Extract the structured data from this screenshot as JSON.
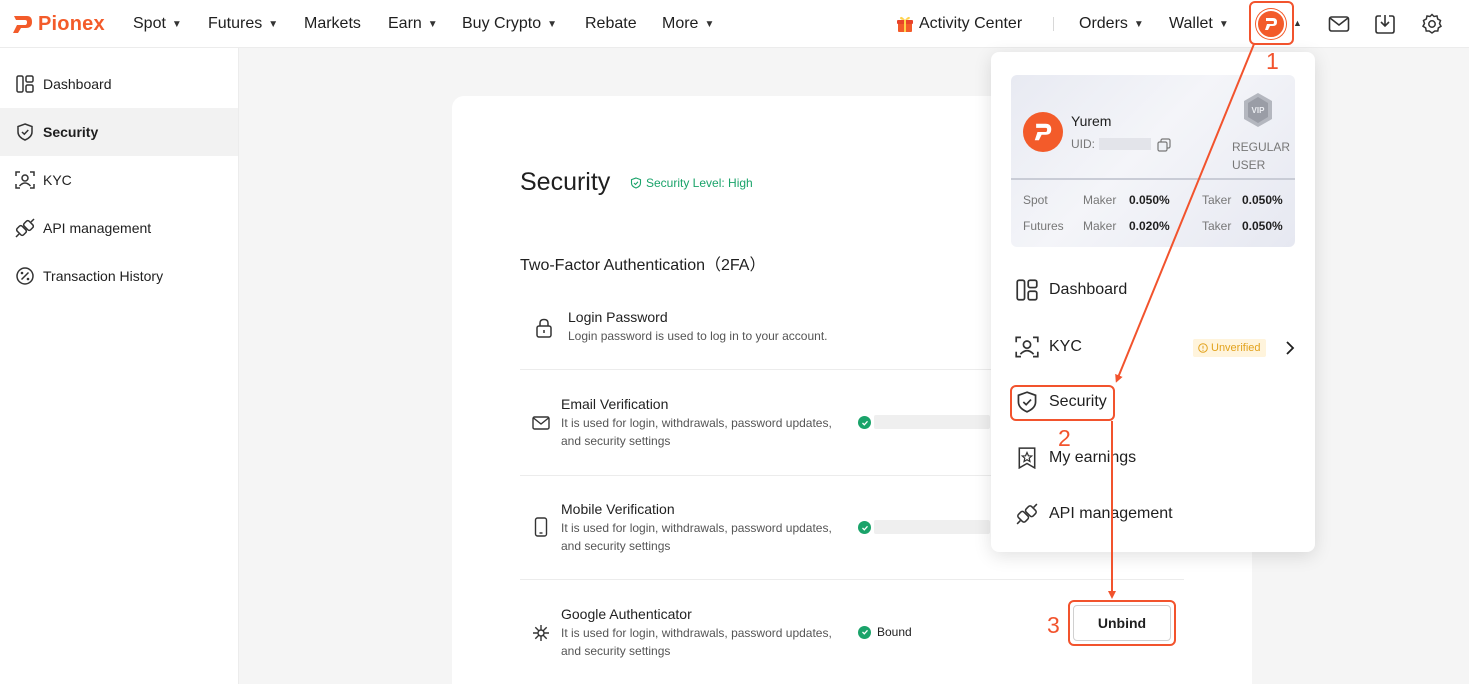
{
  "brand": {
    "name": "Pionex",
    "color": "#f35b2a"
  },
  "nav": {
    "items": [
      {
        "label": "Spot",
        "has_caret": true
      },
      {
        "label": "Futures",
        "has_caret": true
      },
      {
        "label": "Markets",
        "has_caret": false
      },
      {
        "label": "Earn",
        "has_caret": true
      },
      {
        "label": "Buy Crypto",
        "has_caret": true
      },
      {
        "label": "Rebate",
        "has_caret": false
      },
      {
        "label": "More",
        "has_caret": true
      }
    ],
    "activity_center": "Activity Center",
    "orders": "Orders",
    "wallet": "Wallet",
    "icons": [
      "gift-icon",
      "avatar-icon",
      "mail-icon",
      "download-icon",
      "settings-icon"
    ]
  },
  "sidebar": {
    "items": [
      {
        "label": "Dashboard",
        "icon": "dashboard-icon",
        "active": false
      },
      {
        "label": "Security",
        "icon": "shield-icon",
        "active": true
      },
      {
        "label": "KYC",
        "icon": "kyc-icon",
        "active": false
      },
      {
        "label": "API management",
        "icon": "api-icon",
        "active": false
      },
      {
        "label": "Transaction History",
        "icon": "percent-icon",
        "active": false
      }
    ]
  },
  "main": {
    "title": "Security",
    "security_level": "Security Level: High",
    "section_title": "Two-Factor Authentication（2FA）",
    "rows": [
      {
        "title": "Login Password",
        "desc": "Login password is used to log in to your account.",
        "icon": "lock-icon"
      },
      {
        "title": "Email Verification",
        "desc": "It is used for login, withdrawals, password updates, and security settings",
        "icon": "mail-icon"
      },
      {
        "title": "Mobile Verification",
        "desc": "It is used for login, withdrawals, password updates, and security settings",
        "icon": "phone-icon"
      },
      {
        "title": "Google Authenticator",
        "desc": "It is used for login, withdrawals, password updates, and security settings",
        "icon": "authenticator-icon",
        "status": "Bound",
        "action": "Unbind"
      }
    ]
  },
  "dropdown": {
    "user": {
      "name": "Yurem",
      "uid_label": "UID:",
      "tier": "REGULAR USER",
      "badge": "VIP"
    },
    "fees": [
      {
        "market": "Spot",
        "maker_label": "Maker",
        "maker": "0.050%",
        "taker_label": "Taker",
        "taker": "0.050%"
      },
      {
        "market": "Futures",
        "maker_label": "Maker",
        "maker": "0.020%",
        "taker_label": "Taker",
        "taker": "0.050%"
      }
    ],
    "menu": [
      {
        "label": "Dashboard",
        "icon": "dashboard-icon"
      },
      {
        "label": "KYC",
        "icon": "kyc-icon",
        "badge": "Unverified"
      },
      {
        "label": "Security",
        "icon": "shield-icon"
      },
      {
        "label": "My earnings",
        "icon": "earnings-icon"
      },
      {
        "label": "API management",
        "icon": "api-icon"
      }
    ]
  },
  "annotations": {
    "step1": "1",
    "step2": "2",
    "step3": "3",
    "color": "#f2532d"
  },
  "colors": {
    "accent": "#f35b2a",
    "success": "#1aa36a",
    "warning": "#e2a21d"
  }
}
